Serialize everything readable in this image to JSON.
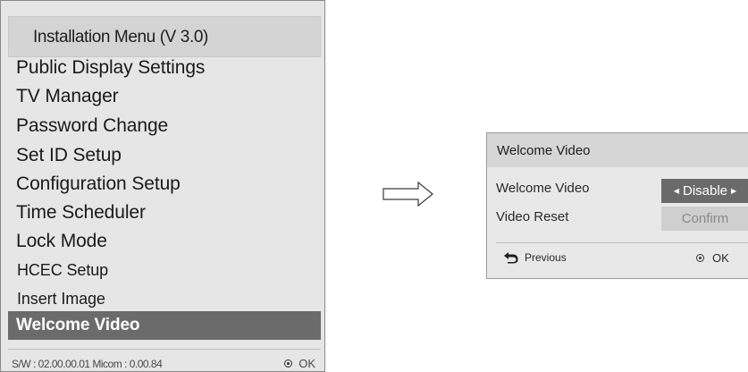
{
  "install_menu": {
    "title": "Installation Menu (V 3.0)",
    "items": [
      {
        "label": "Public Display Settings"
      },
      {
        "label": "TV Manager"
      },
      {
        "label": "Password Change"
      },
      {
        "label": "Set ID Setup"
      },
      {
        "label": "Configuration Setup"
      },
      {
        "label": "Time Scheduler"
      },
      {
        "label": "Lock Mode"
      },
      {
        "label": "HCEC Setup"
      },
      {
        "label": "Insert Image"
      },
      {
        "label": "Welcome Video"
      }
    ],
    "selected_item": "Welcome Video",
    "footer": {
      "sw_info": "S/W : 02.00.00.01 Micom : 0.00.84",
      "ok_label": "OK",
      "ok_icon": "radio-ok-icon"
    }
  },
  "arrow": {
    "icon": "right-arrow-icon"
  },
  "welcome_video_dialog": {
    "title": "Welcome Video",
    "rows": [
      {
        "label": "Welcome Video",
        "value": "Disable"
      },
      {
        "label": "Video Reset",
        "value": "Confirm"
      }
    ],
    "previous_label": "Previous",
    "previous_icon": "return-arrow-icon",
    "ok_label": "OK",
    "ok_icon": "radio-ok-icon"
  },
  "colors": {
    "panel_bg": "#e6e6e6",
    "header_bg": "#d4d4d4",
    "selected_bg": "#6b6b6b",
    "selected_text": "#ffffff",
    "disabled_button_bg": "#cfcfcf"
  }
}
